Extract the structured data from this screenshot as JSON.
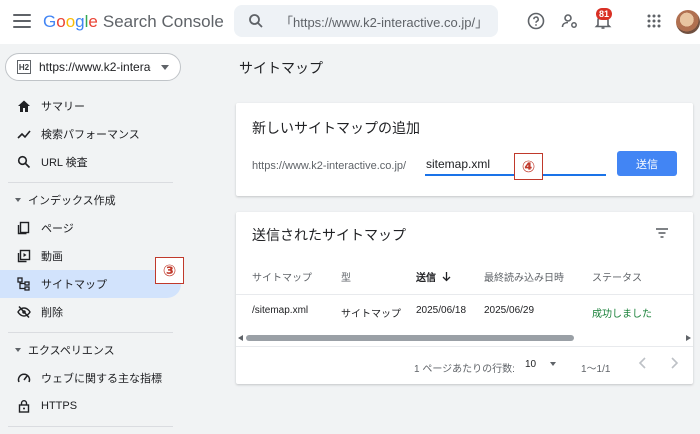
{
  "app": {
    "logo_letters": [
      "G",
      "o",
      "o",
      "g",
      "l",
      "e"
    ],
    "product_name": "Search Console"
  },
  "header": {
    "search_text": "「https://www.k2-interactive.co.jp/」",
    "notification_count": "81",
    "icons": [
      "menu-icon",
      "search-icon",
      "help-icon",
      "manage-users-icon",
      "bell-icon",
      "apps-icon"
    ]
  },
  "sidebar": {
    "property_icon_text": "H2",
    "property_label": "https://www.k2-interac...",
    "items": [
      {
        "label": "サマリー",
        "icon": "home-icon"
      },
      {
        "label": "検索パフォーマンス",
        "icon": "trending-icon"
      },
      {
        "label": "URL 検査",
        "icon": "search-icon"
      }
    ],
    "section_index": {
      "title": "インデックス作成",
      "items": [
        {
          "label": "ページ",
          "icon": "pages-icon"
        },
        {
          "label": "動画",
          "icon": "video-icon"
        },
        {
          "label": "サイトマップ",
          "icon": "sitemap-icon"
        },
        {
          "label": "削除",
          "icon": "visibility-off-icon"
        }
      ]
    },
    "section_experience": {
      "title": "エクスペリエンス",
      "items": [
        {
          "label": "ウェブに関する主な指標",
          "icon": "speed-icon"
        },
        {
          "label": "HTTPS",
          "icon": "lock-icon"
        }
      ]
    }
  },
  "main": {
    "page_title": "サイトマップ",
    "add_card": {
      "title": "新しいサイトマップの追加",
      "url_prefix": "https://www.k2-interactive.co.jp/",
      "input_value": "sitemap.xml",
      "submit_label": "送信"
    },
    "submitted_card": {
      "title": "送信されたサイトマップ",
      "columns": [
        "サイトマップ",
        "型",
        "送信",
        "最終読み込み日時",
        "ステータス"
      ],
      "rows": [
        [
          "/sitemap.xml",
          "サイトマップ",
          "2025/06/18",
          "2025/06/29",
          "成功しました"
        ]
      ],
      "rows_per_page_label": "1 ページあたりの行数:",
      "rows_per_page": "10",
      "range": "1〜1/1"
    }
  },
  "annotations": [
    "③",
    "④"
  ],
  "colors": {
    "primary": "#1a73e8",
    "button": "#4285f4",
    "success": "#188038",
    "active_nav": "#d2e3fc",
    "annotation": "#c0392b"
  }
}
